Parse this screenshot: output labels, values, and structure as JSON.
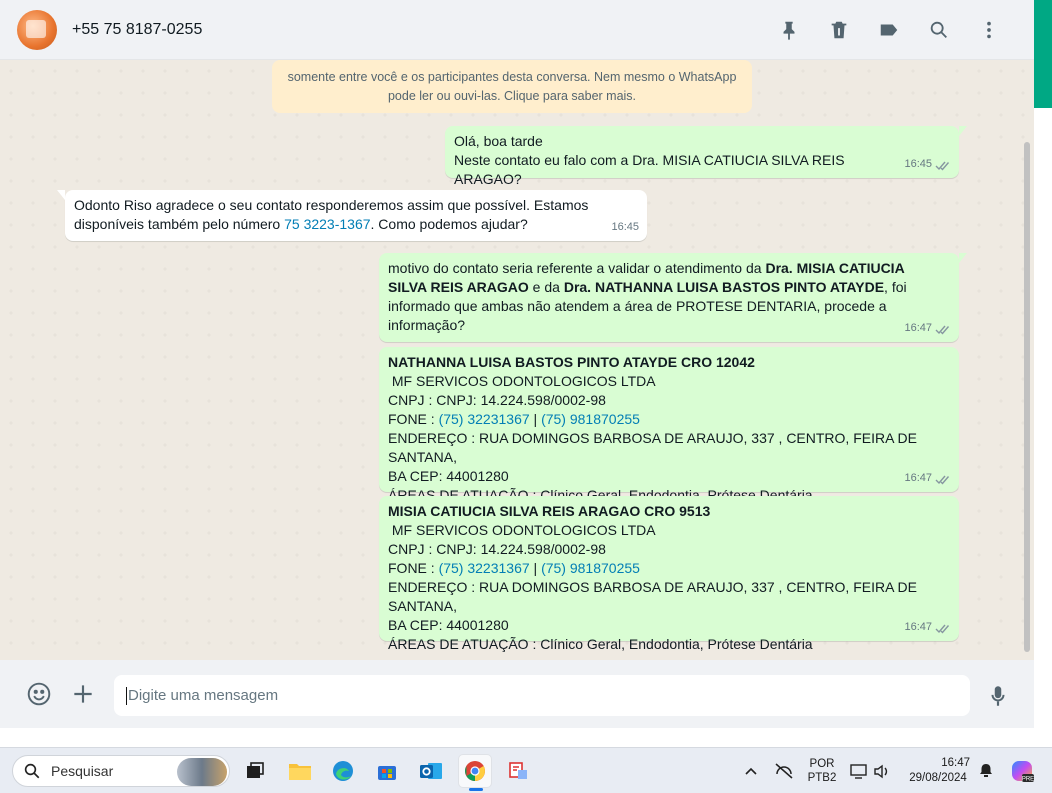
{
  "header": {
    "contact": "+55 75 8187-0255",
    "icons": [
      "pin-icon",
      "delete-icon",
      "label-icon",
      "search-icon",
      "menu-dots-icon"
    ]
  },
  "encryption_notice": {
    "line1": "somente entre você e os participantes desta conversa. Nem mesmo o WhatsApp",
    "line2": "pode ler ou ouvi-las. Clique para saber mais."
  },
  "messages": [
    {
      "direction": "out",
      "line1": "Olá, boa tarde",
      "line2": "Neste contato eu falo com a Dra. MISIA CATIUCIA SILVA REIS ARAGAO?",
      "time": "16:45"
    },
    {
      "direction": "in",
      "line1": "Odonto Riso agradece o seu contato responderemos assim que possível. Estamos",
      "line2_pre": "disponíveis também pelo número ",
      "line2_link": "75 3223-1367",
      "line2_post": ". Como podemos ajudar?",
      "time": "16:45"
    },
    {
      "direction": "out",
      "t1": "motivo do contato seria referente a validar o atendimento da ",
      "b1": "Dra. MISIA CATIUCIA",
      "b2": "SILVA REIS ARAGAO",
      "t2": " e da ",
      "b3": "Dra. NATHANNA LUISA BASTOS PINTO ATAYDE",
      "t3": ", foi",
      "line3": "informado que ambas não atendem a área de PROTESE DENTARIA, procede a informação?",
      "time": "16:47"
    },
    {
      "direction": "out",
      "title": "NATHANNA LUISA BASTOS PINTO ATAYDE  CRO 12042",
      "company": " MF SERVICOS ODONTOLOGICOS LTDA",
      "cnpj": "CNPJ : CNPJ: 14.224.598/0002-98",
      "fone_label": "FONE : ",
      "phone1": "(75) 32231367",
      "sep": " | ",
      "phone2": "(75) 981870255",
      "address1": "ENDEREÇO : RUA DOMINGOS BARBOSA DE ARAUJO, 337 , CENTRO, FEIRA DE SANTANA,",
      "address2": "BA CEP: 44001280",
      "areas": "ÁREAS DE ATUAÇÃO : Clínico Geral, Endodontia, Prótese Dentária",
      "time": "16:47"
    },
    {
      "direction": "out",
      "title": "MISIA CATIUCIA SILVA REIS ARAGAO  CRO 9513",
      "company": " MF SERVICOS ODONTOLOGICOS LTDA",
      "cnpj": "CNPJ : CNPJ: 14.224.598/0002-98",
      "fone_label": "FONE : ",
      "phone1": "(75) 32231367",
      "sep": " | ",
      "phone2": "(75) 981870255",
      "address1": "ENDEREÇO : RUA DOMINGOS BARBOSA DE ARAUJO, 337 , CENTRO, FEIRA DE SANTANA,",
      "address2": "BA CEP: 44001280",
      "areas": "ÁREAS DE ATUAÇÃO : Clínico Geral, Endodontia, Prótese Dentária",
      "time": "16:47"
    }
  ],
  "composer": {
    "placeholder": "Digite uma mensagem"
  },
  "taskbar": {
    "search_label": "Pesquisar",
    "lang_top": "POR",
    "lang_bottom": "PTB2",
    "time": "16:47",
    "date": "29/08/2024"
  }
}
